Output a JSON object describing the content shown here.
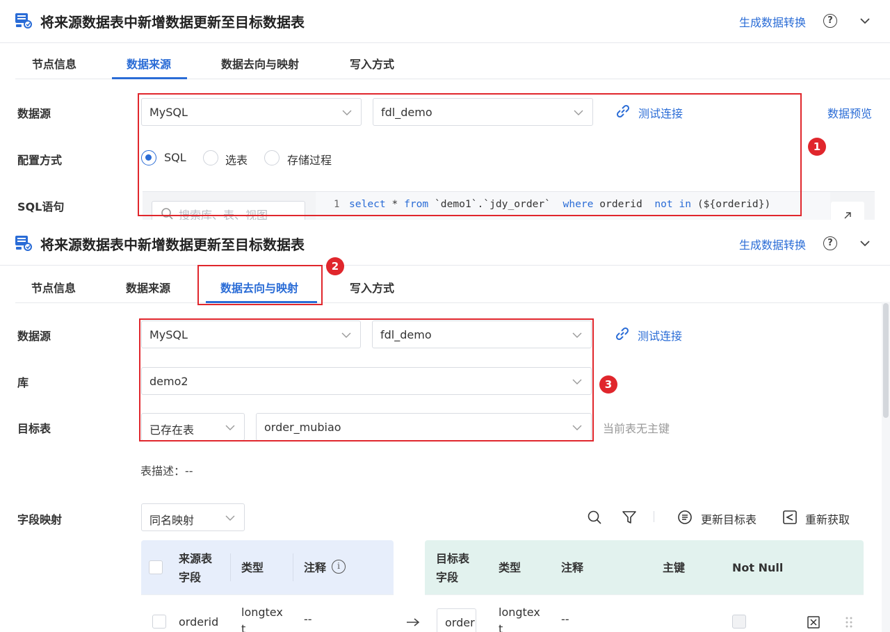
{
  "panels": [
    {
      "title": "将来源数据表中新增数据更新至目标数据表",
      "gen_link": "生成数据转换",
      "tabs": [
        "节点信息",
        "数据来源",
        "数据去向与映射",
        "写入方式"
      ],
      "active_tab": "数据来源",
      "datasource_label": "数据源",
      "datasource_type": "MySQL",
      "datasource_conn": "fdl_demo",
      "test_connection": "测试连接",
      "data_preview": "数据预览",
      "config_label": "配置方式",
      "config_options": [
        "SQL",
        "选表",
        "存储过程"
      ],
      "config_selected": "SQL",
      "sql_label": "SQL语句",
      "sql_search_placeholder": "搜索库、表、视图",
      "sql_line_no": "1",
      "sql_code": {
        "kw1": "select",
        "p1": " * ",
        "kw2": "from",
        "p2": " `demo1`.`jdy_order`  ",
        "kw3": "where",
        "p3": " orderid  ",
        "kw4": "not in",
        "p4": " (${orderid})"
      },
      "badge": "1"
    },
    {
      "title": "将来源数据表中新增数据更新至目标数据表",
      "gen_link": "生成数据转换",
      "tabs": [
        "节点信息",
        "数据来源",
        "数据去向与映射",
        "写入方式"
      ],
      "active_tab": "数据去向与映射",
      "tab_badge": "2",
      "datasource_label": "数据源",
      "datasource_type": "MySQL",
      "datasource_conn": "fdl_demo",
      "test_connection": "测试连接",
      "db_label": "库",
      "db_value": "demo2",
      "target_label": "目标表",
      "target_mode": "已存在表",
      "target_table": "order_mubiao",
      "no_pk_hint": "当前表无主键",
      "box_badge": "3",
      "table_desc": "表描述：--",
      "mapping_label": "字段映射",
      "mapping_mode": "同名映射",
      "update_target": "更新目标表",
      "refetch": "重新获取",
      "source_headers": [
        "来源表\n字段",
        "类型",
        "注释"
      ],
      "target_headers": [
        "目标表\n字段",
        "类型",
        "注释",
        "主键",
        "Not Null"
      ],
      "rows": [
        {
          "src_field": "orderid",
          "src_type": "longtex\nt",
          "src_comment": "--",
          "tgt_field": "orderid",
          "tgt_type": "longtex\nt",
          "tgt_comment": "--"
        }
      ]
    }
  ],
  "colors": {
    "accent": "#2a6cd6",
    "highlight": "#e0262c",
    "source_header_bg": "#e7eefb",
    "target_header_bg": "#e2f2ee"
  },
  "icons": [
    "table-sync-icon",
    "help-icon",
    "chevron-down-icon",
    "link-icon",
    "search-icon",
    "filter-icon",
    "update-icon",
    "refresh-icon",
    "info-icon",
    "arrow-right-icon",
    "delete-icon",
    "drag-handle-icon"
  ]
}
